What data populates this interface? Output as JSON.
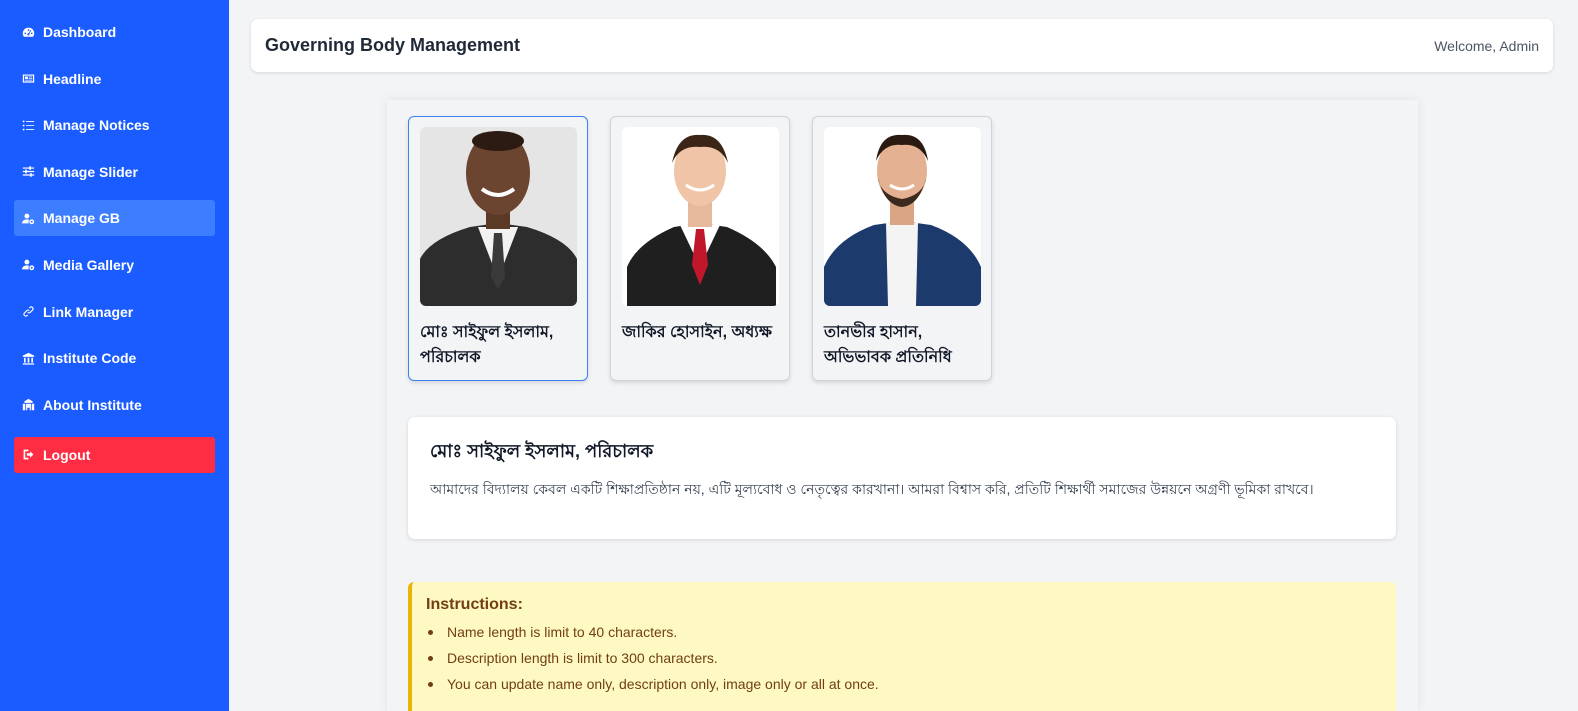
{
  "sidebar": {
    "items": [
      {
        "label": "Dashboard",
        "icon": "dashboard-icon"
      },
      {
        "label": "Headline",
        "icon": "newspaper-icon"
      },
      {
        "label": "Manage Notices",
        "icon": "list-icon"
      },
      {
        "label": "Manage Slider",
        "icon": "sliders-icon"
      },
      {
        "label": "Manage GB",
        "icon": "user-gear-icon",
        "active": true
      },
      {
        "label": "Media Gallery",
        "icon": "user-gear-icon"
      },
      {
        "label": "Link Manager",
        "icon": "link-icon"
      },
      {
        "label": "Institute Code",
        "icon": "building-columns-icon"
      },
      {
        "label": "About Institute",
        "icon": "school-icon"
      }
    ],
    "logout": {
      "label": "Logout",
      "icon": "logout-icon"
    }
  },
  "header": {
    "title": "Governing Body Management",
    "welcome": "Welcome, Admin"
  },
  "members": [
    {
      "name": "মোঃ সাইফুল ইসলাম, পরিচালক",
      "selected": true
    },
    {
      "name": "জাকির হোসাইন, অধ্যক্ষ",
      "selected": false
    },
    {
      "name": "তানভীর হাসান, অভিভাবক প্রতিনিধি",
      "selected": false
    }
  ],
  "detail": {
    "name": "মোঃ সাইফুল ইসলাম, পরিচালক",
    "description": "আমাদের বিদ্যালয় কেবল একটি শিক্ষাপ্রতিষ্ঠান নয়, এটি মূল্যবোধ ও নেতৃত্বের কারখানা। আমরা বিশ্বাস করি, প্রতিটি শিক্ষার্থী সমাজের উন্নয়নে অগ্রণী ভূমিকা রাখবে।"
  },
  "instructions": {
    "title": "Instructions:",
    "items": [
      "Name length is limit to 40 characters.",
      "Description length is limit to 300 characters.",
      "You can update name only, description only, image only or all at once."
    ]
  },
  "colors": {
    "sidebar": "#1a5cff",
    "active": "#3d7dff",
    "logout": "#ff2d43",
    "selected_border": "#3b82f6",
    "instructions_bg": "#fef8c3",
    "instructions_border": "#eab308"
  }
}
